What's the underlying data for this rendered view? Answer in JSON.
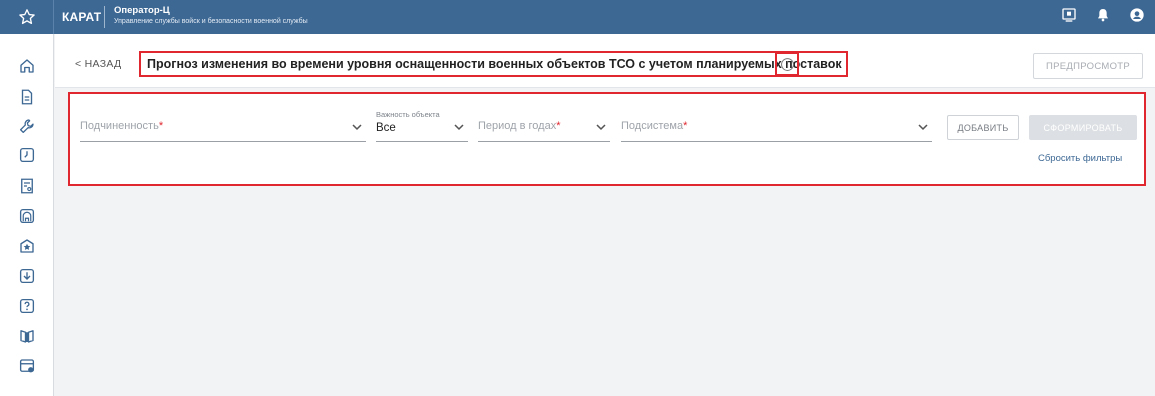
{
  "topbar": {
    "brand": "КАРАТ",
    "app_name": "Оператор-Ц",
    "app_subtitle": "Управление службы войск и безопасности военной службы",
    "icons": [
      "star-icon",
      "monitor-icon",
      "bell-icon",
      "user-icon"
    ]
  },
  "sidebar": {
    "icons": [
      "home-icon",
      "document-icon",
      "wrench-icon",
      "clock-icon",
      "report-icon",
      "building-icon",
      "star-badge-icon",
      "download-icon",
      "help-icon",
      "book-icon",
      "calendar-icon"
    ]
  },
  "header": {
    "back_label": "< НАЗАД",
    "title": "Прогноз изменения во времени уровня оснащенности военных объектов ТСО с учетом планируемых поставок",
    "preview_label": "ПРЕДПРОСМОТР"
  },
  "filters": {
    "subordination": {
      "label": "Подчиненность",
      "required_mark": "*"
    },
    "importance": {
      "caption": "Важность объекта",
      "value": "Все"
    },
    "period": {
      "label": "Период в годах",
      "required_mark": "*"
    },
    "subsystem": {
      "label": "Подсистема",
      "required_mark": "*"
    },
    "add_label": "ДОБАВИТЬ",
    "form_label": "СФОРМИРОВАТЬ",
    "reset_label": "Сбросить фильтры"
  },
  "colors": {
    "topbar": "#3d6894",
    "highlight": "#e0262e",
    "required": "#e0262e",
    "link": "#3d6894"
  }
}
